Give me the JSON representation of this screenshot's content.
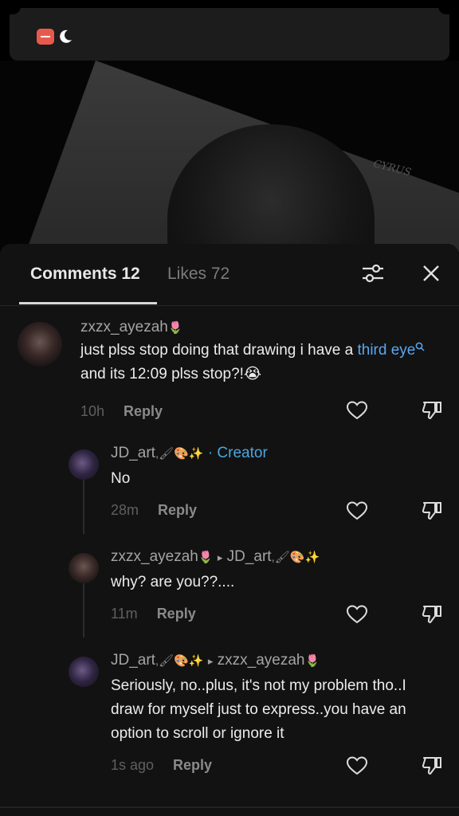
{
  "status": {
    "icons": [
      "do-not-disturb-icon",
      "moon-icon"
    ]
  },
  "video": {
    "signature": "CYRUS"
  },
  "header": {
    "comments_tab": "Comments 12",
    "likes_tab": "Likes 72"
  },
  "colors": {
    "creator": "#4ba6e0",
    "link": "#59a8f0",
    "background": "#121212"
  },
  "comments": [
    {
      "username": "zxzx_ayezah",
      "text_before": "just plss stop doing that drawing i have a ",
      "link_text": "third eye",
      "text_after": " and its 12:09 plss stop?!😭",
      "time": "10h",
      "reply": "Reply"
    },
    {
      "username": "JD_art",
      "badge": "· Creator",
      "text": "No",
      "time": "28m",
      "reply": "Reply"
    },
    {
      "username": "zxzx_ayezah",
      "reply_to": "JD_art",
      "text": "why? are you??....",
      "time": "11m",
      "reply": "Reply"
    },
    {
      "username": "JD_art",
      "reply_to": "zxzx_ayezah",
      "text": "Seriously, no..plus, it's not my problem tho..I draw for myself just to express..you have an option to scroll or ignore it",
      "time": "1s ago",
      "reply": "Reply"
    }
  ]
}
